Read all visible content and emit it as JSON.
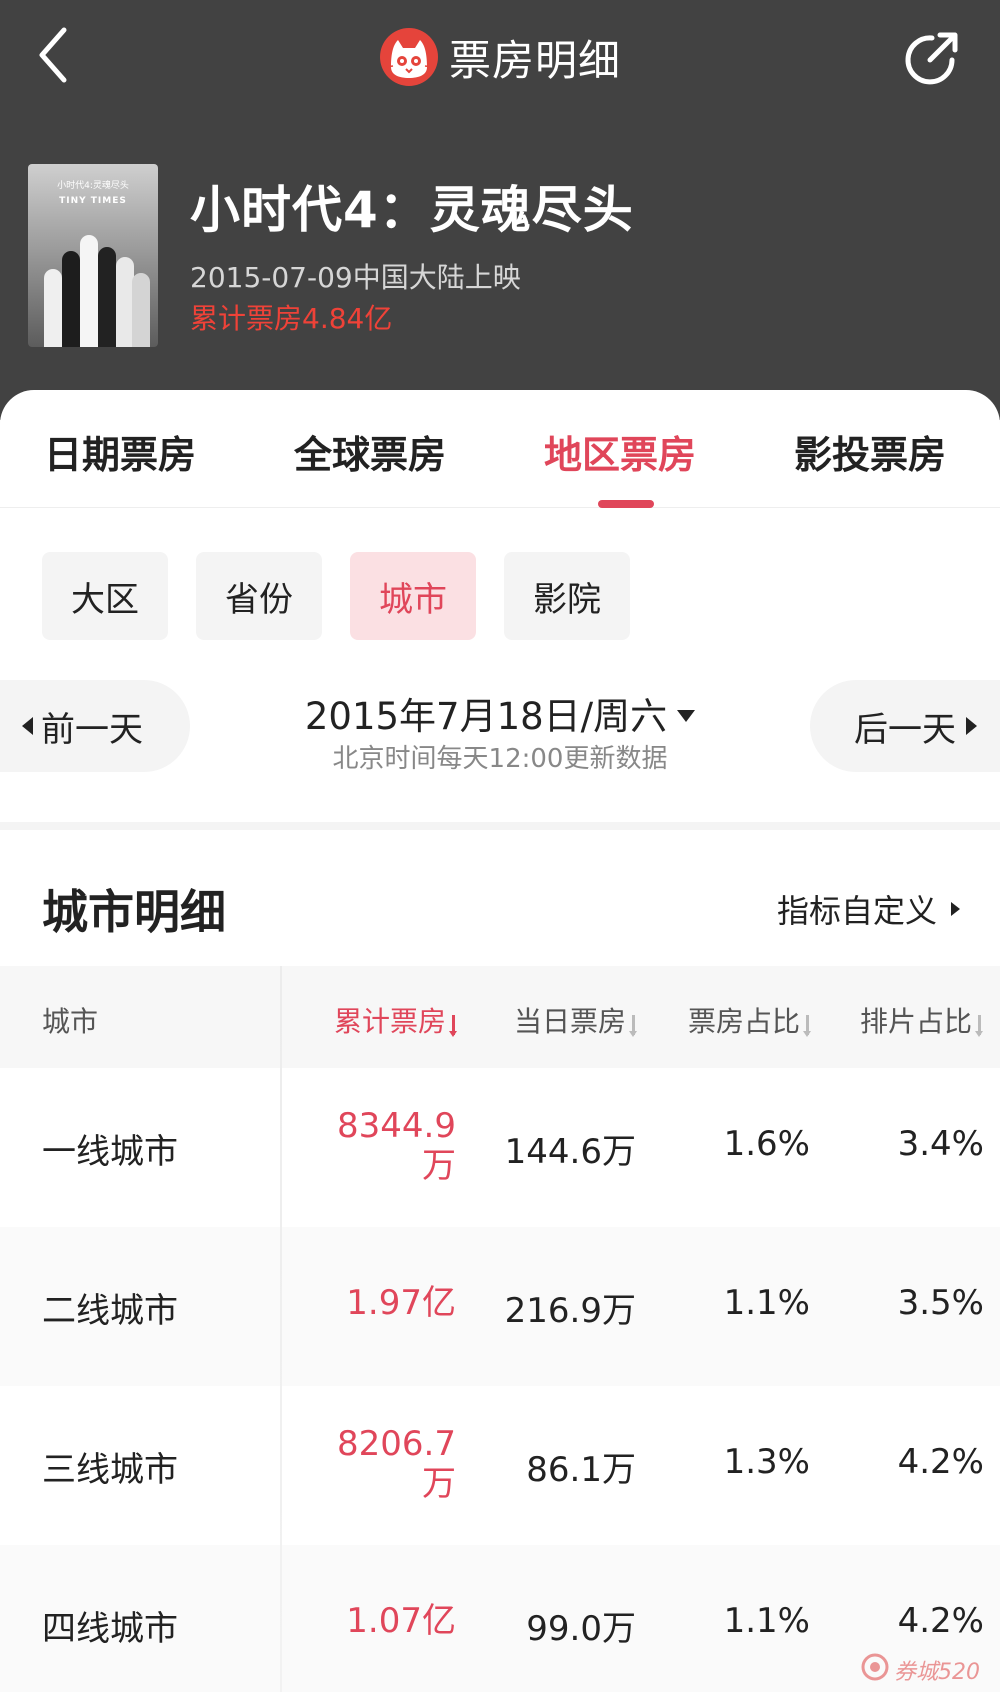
{
  "header": {
    "title": "票房明细"
  },
  "movie": {
    "name": "小时代4：灵魂尽头",
    "release": "2015-07-09中国大陆上映",
    "total": "累计票房4.84亿",
    "poster_text_1": "小时代4:灵魂尽头",
    "poster_text_2": "TINY TIMES"
  },
  "tabs": [
    {
      "label": "日期票房",
      "active": false
    },
    {
      "label": "全球票房",
      "active": false
    },
    {
      "label": "地区票房",
      "active": true
    },
    {
      "label": "影投票房",
      "active": false
    }
  ],
  "segments": [
    {
      "label": "大区",
      "active": false
    },
    {
      "label": "省份",
      "active": false
    },
    {
      "label": "城市",
      "active": true
    },
    {
      "label": "影院",
      "active": false
    }
  ],
  "date_nav": {
    "prev": "前一天",
    "next": "后一天",
    "date": "2015年7月18日/周六",
    "note": "北京时间每天12:00更新数据"
  },
  "detail": {
    "title": "城市明细",
    "custom": "指标自定义",
    "columns": [
      "城市",
      "累计票房",
      "当日票房",
      "票房占比",
      "排片占比"
    ],
    "rows": [
      {
        "city": "一线城市",
        "total": "8344.9万",
        "total_l1": "8344.9",
        "total_l2": "万",
        "today": "144.6万",
        "share": "1.6%",
        "schedule": "3.4%"
      },
      {
        "city": "二线城市",
        "total": "1.97亿",
        "total_l1": "1.97亿",
        "total_l2": "",
        "today": "216.9万",
        "share": "1.1%",
        "schedule": "3.5%"
      },
      {
        "city": "三线城市",
        "total": "8206.7万",
        "total_l1": "8206.7",
        "total_l2": "万",
        "today": "86.1万",
        "share": "1.3%",
        "schedule": "4.2%"
      },
      {
        "city": "四线城市",
        "total": "1.07亿",
        "total_l1": "1.07亿",
        "total_l2": "",
        "today": "99.0万",
        "share": "1.1%",
        "schedule": "4.2%"
      }
    ]
  },
  "watermark": "券城520",
  "colors": {
    "accent": "#e0465a",
    "header_bg": "#424242",
    "total_red": "#ef4238"
  }
}
